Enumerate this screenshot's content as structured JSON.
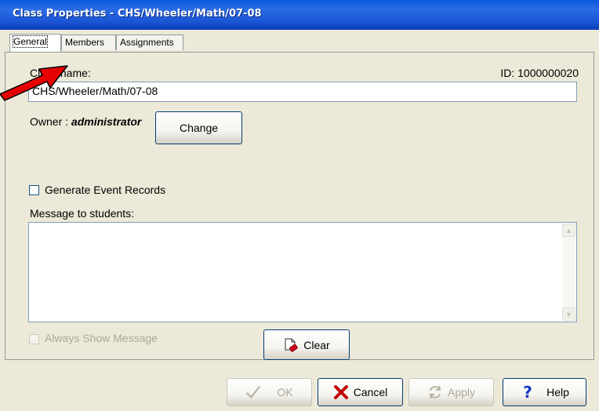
{
  "window": {
    "title": "Class Properties - CHS/Wheeler/Math/07-08"
  },
  "tabs": [
    {
      "label": "General",
      "active": true
    },
    {
      "label": "Members",
      "active": false
    },
    {
      "label": "Assignments",
      "active": false
    }
  ],
  "general": {
    "class_name_label": "Class name:",
    "id_text": "ID: 1000000020",
    "class_name_value": "CHS/Wheeler/Math/07-08",
    "owner_prefix": "Owner : ",
    "owner_name": "administrator",
    "change_button": "Change",
    "generate_event_label": "Generate Event Records",
    "generate_event_checked": false,
    "message_label": "Message to students:",
    "message_value": "",
    "always_show_label": "Always Show Message",
    "always_show_checked": false,
    "clear_button": "Clear"
  },
  "footer": {
    "ok": "OK",
    "cancel": "Cancel",
    "apply": "Apply",
    "help": "Help"
  },
  "icons": {
    "ok": "check-icon",
    "cancel": "x-icon",
    "apply": "refresh-icon",
    "help": "question-icon",
    "clear": "eraser-page-icon",
    "annotation": "red-arrow"
  },
  "colors": {
    "title_bar": "#0A58DB",
    "window_bg": "#ECE9D8",
    "cancel_x": "#C00000",
    "help_q": "#1A35C8",
    "annotation_arrow": "#E60000"
  }
}
